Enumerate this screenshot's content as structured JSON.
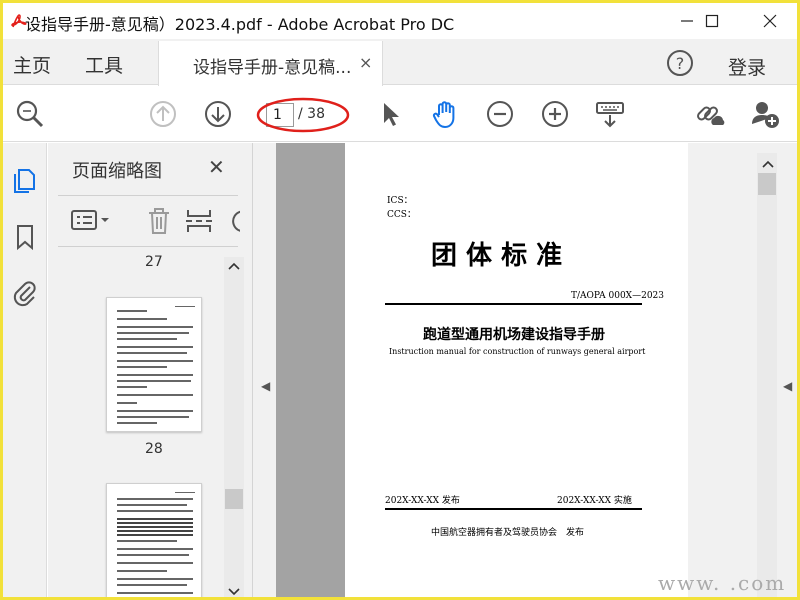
{
  "window": {
    "title": "设指导手册-意见稿）2023.4.pdf - Adobe Acrobat Pro DC"
  },
  "menu": {
    "home": "主页",
    "tools": "工具",
    "doc_tab": "设指导手册-意见稿...",
    "doc_tab_close": "×",
    "login": "登录"
  },
  "toolbar": {
    "page_current": "1",
    "page_total": "/ 38"
  },
  "thumbnails": {
    "panel_title": "页面缩略图",
    "close": "✕",
    "labels": [
      "27",
      "28"
    ]
  },
  "page": {
    "ics": "ICS：",
    "ccs": "CCS：",
    "heading": "团 体 标 准",
    "code": "T/AOPA 000X—2023",
    "title_cn": "跑道型通用机场建设指导手册",
    "title_en": "Instruction manual for construction of runways general airport",
    "release_date": "202X-XX-XX 发布",
    "effective_date": "202X-XX-XX 实施",
    "publisher": "中国航空器拥有者及驾驶员协会　发布"
  },
  "watermark": "www.        .com",
  "colors": {
    "border": "#f2e13a",
    "accent_blue": "#1473e6",
    "annotation_red": "#e0201b",
    "pdf_red": "#e3201b"
  },
  "icons": {
    "app": "acrobat-icon",
    "search": "zoom-search-icon",
    "up": "arrow-up-icon",
    "down": "arrow-down-icon",
    "select": "cursor-icon",
    "hand": "hand-icon",
    "zoom_out": "zoom-out-icon",
    "zoom_in": "zoom-in-icon",
    "keyboard": "keyboard-icon",
    "share_link": "link-share-icon",
    "add_user": "add-user-icon"
  }
}
